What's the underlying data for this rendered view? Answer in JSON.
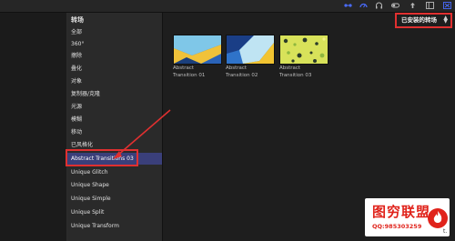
{
  "toolbar": {
    "icons": [
      "connect-icon",
      "speed-icon",
      "headphones-icon",
      "toggle-icon",
      "share-icon",
      "layout-icon",
      "close-icon"
    ]
  },
  "sidebar": {
    "title": "转场",
    "items": [
      {
        "label": "全部"
      },
      {
        "label": "360°"
      },
      {
        "label": "擦除"
      },
      {
        "label": "叠化"
      },
      {
        "label": "对象"
      },
      {
        "label": "复制器/克隆"
      },
      {
        "label": "光源"
      },
      {
        "label": "模糊"
      },
      {
        "label": "移动"
      },
      {
        "label": "已风格化"
      },
      {
        "label": "Abstract Transitions 03",
        "selected": true
      },
      {
        "label": "Unique Glitch"
      },
      {
        "label": "Unique Shape"
      },
      {
        "label": "Unique Simple"
      },
      {
        "label": "Unique Split"
      },
      {
        "label": "Unique Transform"
      }
    ]
  },
  "filter": {
    "label": "已安装的转场",
    "icon": "updown-chevron-icon"
  },
  "thumbnails": [
    {
      "line1": "Abstract",
      "line2": "Transition 01",
      "colors": [
        "#2a63b8",
        "#f0c23a",
        "#7fc7e8",
        "#1b3f7c"
      ]
    },
    {
      "line1": "Abstract",
      "line2": "Transition 02",
      "colors": [
        "#2f73c9",
        "#f2c431",
        "#bfe4f3",
        "#1a3e86"
      ]
    },
    {
      "line1": "Abstract",
      "line2": "Transition 03",
      "colors": [
        "#d8e25a",
        "#2a3a2a",
        "#8fb83f",
        "#f2f08a"
      ]
    }
  ],
  "annotation": {
    "color": "#e03030"
  },
  "watermark": {
    "title": "图穷联盟",
    "qq": "QQ:985303259",
    "suffix": "t.",
    "accent": "#e0231b"
  }
}
